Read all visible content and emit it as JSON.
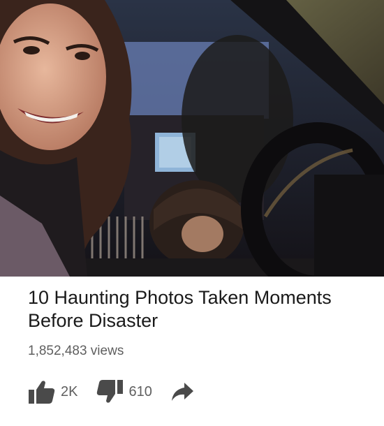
{
  "video": {
    "title": "10 Haunting Photos Taken Moments Before Disaster",
    "views": "1,852,483 views"
  },
  "actions": {
    "like": {
      "icon": "thumbs-up-icon",
      "count": "2K"
    },
    "dislike": {
      "icon": "thumbs-down-icon",
      "count": "610"
    },
    "share": {
      "icon": "share-arrow-icon"
    }
  },
  "colors": {
    "title_text": "#1a1a1a",
    "meta_text": "#5f5f5f",
    "icon": "#4a4a4a"
  }
}
